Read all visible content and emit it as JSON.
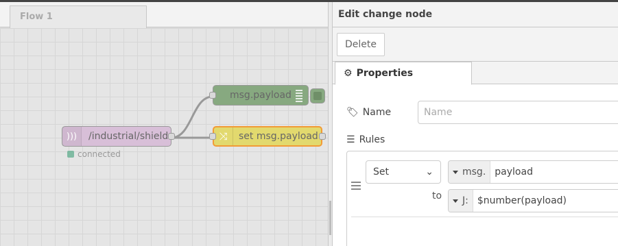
{
  "workspace": {
    "flow_tab": "Flow 1",
    "nodes": {
      "mqtt_label": "/industrial/shields",
      "mqtt_status": "connected",
      "debug_label": "msg.payload",
      "change_label": "set msg.payload"
    }
  },
  "editor": {
    "title": "Edit change node",
    "delete_label": "Delete",
    "tab_properties": "Properties",
    "name_label": "Name",
    "name_placeholder": "Name",
    "rules_label": "Rules",
    "rule": {
      "action": "Set",
      "target_type": "msg.",
      "target_value": "payload",
      "to_label": "to",
      "value_type_icon": "J:",
      "value": "$number(payload)"
    }
  },
  "icons": {
    "tag": "tag-icon",
    "gear": "gear-icon",
    "list": "list-icon",
    "drag": "drag-handle-icon",
    "change": "shuffle-icon",
    "mqtt": "signal-icon"
  }
}
